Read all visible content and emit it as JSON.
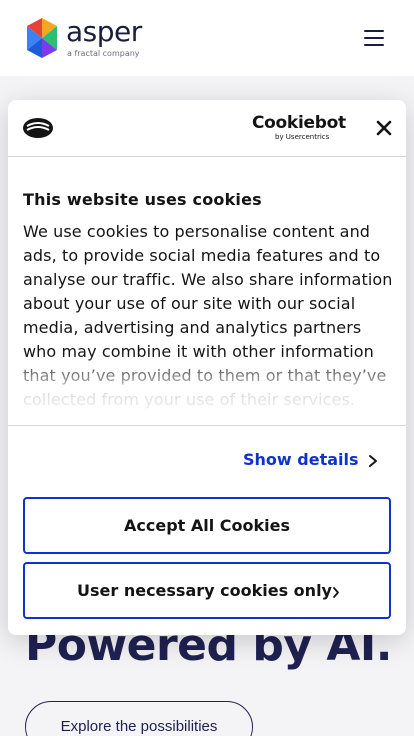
{
  "header": {
    "brand": "asper",
    "tagline": "a fractal company",
    "menu_icon": "hamburger-menu-icon"
  },
  "hero": {
    "title": "Powered by AI.",
    "cta": "Explore the possibilities"
  },
  "cookie_dialog": {
    "provider": "Cookiebot",
    "provider_sub": "by Usercentrics",
    "close_icon": "close-icon",
    "title": "This website uses cookies",
    "body": "We use cookies to personalise content and ads, to provide social media features and to analyse our traffic. We also share information about your use of our site with our social media, advertising and analytics partners who may combine it with other information that you’ve provided to them or that they’ve collected from your use of their services.",
    "show_details": "Show details",
    "accept_all": "Accept All Cookies",
    "necessary_only": "User necessary cookies only"
  },
  "colors": {
    "accent": "#1032cf",
    "brand_dark": "#1f2151",
    "page_bg": "#f4f4f7"
  }
}
